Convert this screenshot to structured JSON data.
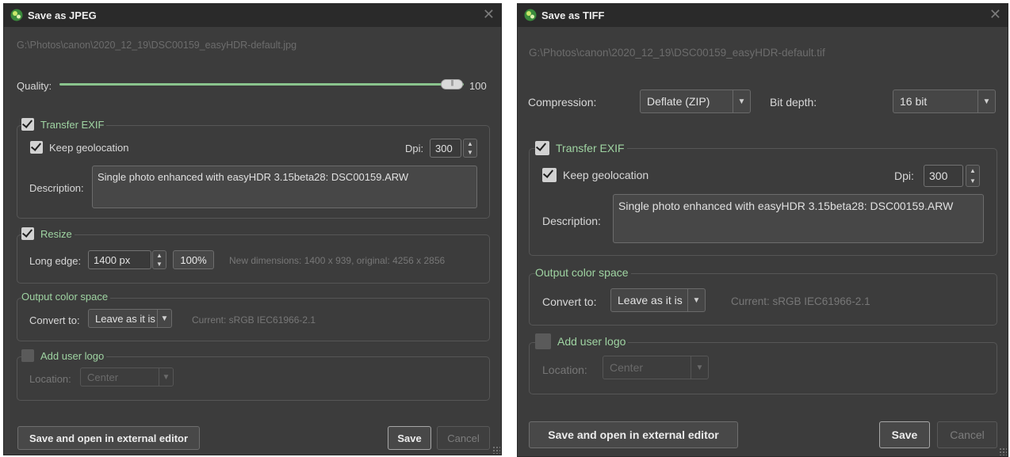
{
  "jpeg_dialog": {
    "title": "Save as JPEG",
    "path": "G:\\Photos\\canon\\2020_12_19\\DSC00159_easyHDR-default.jpg",
    "quality": {
      "label": "Quality:",
      "value": "100",
      "fraction": 1.0
    },
    "transfer_exif": {
      "label": "Transfer EXIF",
      "checked": true,
      "keep_geolocation": {
        "label": "Keep geolocation",
        "checked": true
      },
      "dpi_label": "Dpi:",
      "dpi_value": "300",
      "description_label": "Description:",
      "description_value": "Single photo enhanced with easyHDR 3.15beta28: DSC00159.ARW"
    },
    "resize": {
      "label": "Resize",
      "checked": true,
      "long_edge_label": "Long edge:",
      "long_edge_value": "1400 px",
      "percent_button": "100%",
      "dimensions_info": "New dimensions: 1400 x 939, original: 4256 x 2856"
    },
    "output_color_space": {
      "label": "Output color space",
      "convert_label": "Convert to:",
      "convert_value": "Leave as it is",
      "current": "Current: sRGB IEC61966-2.1"
    },
    "user_logo": {
      "label": "Add user logo",
      "checked": false,
      "location_label": "Location:",
      "location_value": "Center"
    },
    "buttons": {
      "external": "Save and open in external editor",
      "save": "Save",
      "cancel": "Cancel"
    }
  },
  "tiff_dialog": {
    "title": "Save as TIFF",
    "path": "G:\\Photos\\canon\\2020_12_19\\DSC00159_easyHDR-default.tif",
    "compression_label": "Compression:",
    "compression_value": "Deflate (ZIP)",
    "bit_depth_label": "Bit depth:",
    "bit_depth_value": "16 bit",
    "transfer_exif": {
      "label": "Transfer EXIF",
      "checked": true,
      "keep_geolocation": {
        "label": "Keep geolocation",
        "checked": true
      },
      "dpi_label": "Dpi:",
      "dpi_value": "300",
      "description_label": "Description:",
      "description_value": "Single photo enhanced with easyHDR 3.15beta28: DSC00159.ARW"
    },
    "output_color_space": {
      "label": "Output color space",
      "convert_label": "Convert to:",
      "convert_value": "Leave as it is",
      "current": "Current: sRGB IEC61966-2.1"
    },
    "user_logo": {
      "label": "Add user logo",
      "checked": false,
      "location_label": "Location:",
      "location_value": "Center"
    },
    "buttons": {
      "external": "Save and open in external editor",
      "save": "Save",
      "cancel": "Cancel"
    }
  },
  "icons": {
    "app": "easyhdr-app-icon",
    "close": "close-icon",
    "dropdown": "chevron-down-icon",
    "spin": "spin-arrows-icon",
    "check": "check-icon"
  },
  "colors": {
    "dialog_bg": "#3c3c3c",
    "titlebar_bg": "#2a2a2a",
    "accent_green": "#9fd4a2",
    "slider_green": "#8ac48d"
  }
}
